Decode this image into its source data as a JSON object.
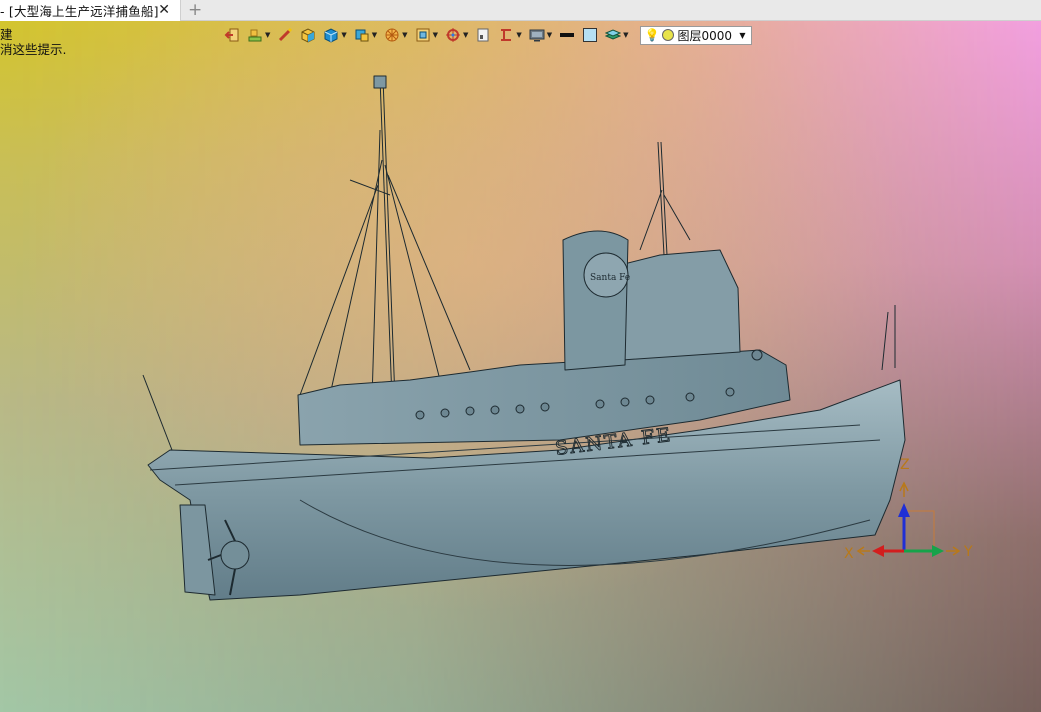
{
  "tab": {
    "title": "- [大型海上生产远洋捕鱼船]",
    "close": "✕",
    "add": "+"
  },
  "prompt": {
    "line1": "建",
    "line2": "消这些提示."
  },
  "toolbar": {
    "icons": [
      "exit-icon",
      "layer-manager-icon",
      "pen-icon",
      "box-shade-icon",
      "cube-icon",
      "view-cube-icon",
      "wheel-icon",
      "frame-icon",
      "target-icon",
      "page-icon",
      "dimension-icon",
      "monitor-icon",
      "line-color-icon",
      "fill-color-icon",
      "layers-icon"
    ],
    "layer_value": "图层0000"
  },
  "hull_text": "SANTA FE",
  "funnel_text": "Santa Fe",
  "triad": {
    "x": "X",
    "y": "Y",
    "z": "Z"
  },
  "colors": {
    "hull": "#7e98a2",
    "hull_shadow": "#5f7985",
    "outline": "#1d2a30"
  }
}
